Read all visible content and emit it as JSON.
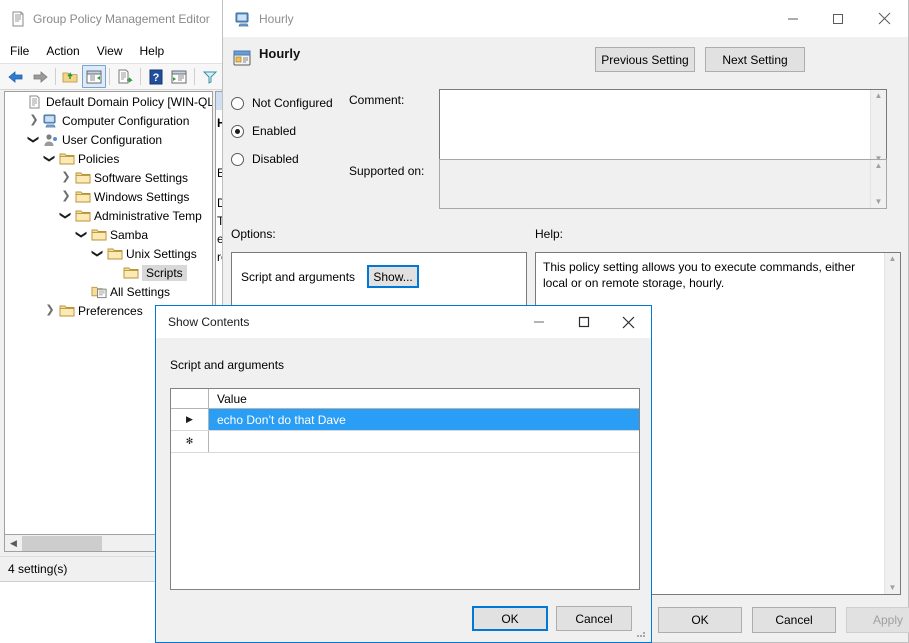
{
  "gpme": {
    "title": "Group Policy Management Editor",
    "menu": [
      "File",
      "Action",
      "View",
      "Help"
    ],
    "toolbar": [
      {
        "name": "back-icon",
        "label": "Back"
      },
      {
        "name": "forward-icon",
        "label": "Forward"
      },
      {
        "name": "up-folder-icon",
        "label": "Up One Level"
      },
      {
        "name": "show-hide-tree-icon",
        "label": "Show/Hide Console Tree"
      },
      {
        "name": "export-list-icon",
        "label": "Export List"
      },
      {
        "name": "help-icon",
        "label": "Help"
      },
      {
        "name": "properties-icon",
        "label": "Properties"
      },
      {
        "name": "filter-icon",
        "label": "Filter"
      }
    ],
    "tree": [
      {
        "label": "Default Domain Policy [WIN-QL",
        "indent": 0,
        "twisty": "none",
        "icon": "policy-doc-icon",
        "selected": false
      },
      {
        "label": "Computer Configuration",
        "indent": 1,
        "twisty": "collapsed",
        "icon": "computer-icon",
        "selected": false
      },
      {
        "label": "User Configuration",
        "indent": 1,
        "twisty": "expanded",
        "icon": "user-icon",
        "selected": false
      },
      {
        "label": "Policies",
        "indent": 2,
        "twisty": "expanded",
        "icon": "folder-icon",
        "selected": false
      },
      {
        "label": "Software Settings",
        "indent": 3,
        "twisty": "collapsed",
        "icon": "folder-icon",
        "selected": false
      },
      {
        "label": "Windows Settings",
        "indent": 3,
        "twisty": "collapsed",
        "icon": "folder-icon",
        "selected": false
      },
      {
        "label": "Administrative Temp",
        "indent": 3,
        "twisty": "expanded",
        "icon": "folder-icon",
        "selected": false
      },
      {
        "label": "Samba",
        "indent": 4,
        "twisty": "expanded",
        "icon": "folder-icon",
        "selected": false
      },
      {
        "label": "Unix Settings",
        "indent": 5,
        "twisty": "expanded",
        "icon": "folder-icon",
        "selected": false
      },
      {
        "label": "Scripts",
        "indent": 6,
        "twisty": "none",
        "icon": "folder-icon",
        "selected": true
      },
      {
        "label": "All Settings",
        "indent": 4,
        "twisty": "none",
        "icon": "all-settings-icon",
        "selected": false
      },
      {
        "label": "Preferences",
        "indent": 2,
        "twisty": "collapsed",
        "icon": "folder-icon",
        "selected": false
      }
    ],
    "status": "4 setting(s)",
    "right_pane_fragments": [
      "H",
      "Ed",
      "De",
      "Th",
      "ex",
      "re"
    ]
  },
  "hourly": {
    "window_title": "Hourly",
    "setting_name": "Hourly",
    "prev_button": "Previous Setting",
    "next_button": "Next Setting",
    "states": [
      {
        "label": "Not Configured",
        "selected": false
      },
      {
        "label": "Enabled",
        "selected": true
      },
      {
        "label": "Disabled",
        "selected": false
      }
    ],
    "comment_label": "Comment:",
    "comment_value": "",
    "supported_label": "Supported on:",
    "supported_value": "",
    "options_label": "Options:",
    "help_label": "Help:",
    "option_row_label": "Script and arguments",
    "show_button": "Show...",
    "help_text": "This policy setting allows you to execute commands, either local or on remote storage, hourly.",
    "buttons": {
      "ok": "OK",
      "cancel": "Cancel",
      "apply": "Apply",
      "apply_disabled": true
    },
    "titlebar_buttons": [
      {
        "name": "minimize-icon",
        "glyph": "–"
      },
      {
        "name": "maximize-icon",
        "glyph": "☐"
      },
      {
        "name": "close-icon",
        "glyph": "✕"
      }
    ]
  },
  "show_contents": {
    "title": "Show Contents",
    "sub_label": "Script and arguments",
    "columns": [
      "",
      "Value"
    ],
    "rows": [
      {
        "marker": "▶",
        "value": "echo Don’t do that Dave",
        "selected": true
      },
      {
        "marker": "✻",
        "value": "",
        "selected": false
      }
    ],
    "buttons": {
      "ok": "OK",
      "cancel": "Cancel"
    },
    "titlebar_buttons": [
      {
        "name": "minimize-icon",
        "glyph": "–"
      },
      {
        "name": "maximize-icon",
        "glyph": "☐"
      },
      {
        "name": "close-icon",
        "glyph": "✕"
      }
    ]
  },
  "colors": {
    "accent_blue": "#0078d7",
    "selection_blue": "#2a9df4",
    "window_bg": "#f0f0f0",
    "field_bg": "#ffffff",
    "inactive_title_text": "#8e8e8e"
  }
}
